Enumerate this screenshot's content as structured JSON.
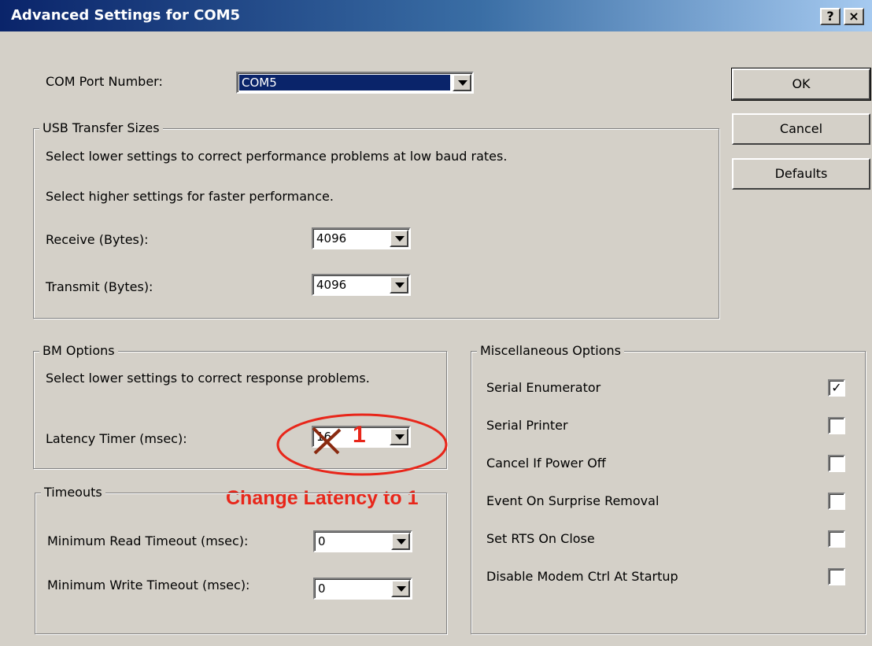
{
  "window": {
    "title": "Advanced Settings for COM5",
    "help_glyph": "?",
    "close_glyph": "×"
  },
  "com_port": {
    "label": "COM Port Number:",
    "value": "COM5"
  },
  "buttons": {
    "ok": "OK",
    "cancel": "Cancel",
    "defaults": "Defaults"
  },
  "usb": {
    "legend": "USB Transfer Sizes",
    "line1": "Select lower settings to correct performance problems at low baud rates.",
    "line2": "Select higher settings for faster performance.",
    "receive_label": "Receive (Bytes):",
    "receive_value": "4096",
    "transmit_label": "Transmit (Bytes):",
    "transmit_value": "4096"
  },
  "bm": {
    "legend": "BM Options",
    "desc": "Select lower settings to correct response problems.",
    "latency_label": "Latency Timer (msec):",
    "latency_value": "16"
  },
  "timeouts": {
    "legend": "Timeouts",
    "read_label": "Minimum Read Timeout (msec):",
    "read_value": "0",
    "write_label": "Minimum Write Timeout (msec):",
    "write_value": "0"
  },
  "misc": {
    "legend": "Miscellaneous Options",
    "options": [
      {
        "label": "Serial Enumerator",
        "checked": true
      },
      {
        "label": "Serial Printer",
        "checked": false
      },
      {
        "label": "Cancel If Power Off",
        "checked": false
      },
      {
        "label": "Event On Surprise Removal",
        "checked": false
      },
      {
        "label": "Set RTS On Close",
        "checked": false
      },
      {
        "label": "Disable Modem Ctrl At Startup",
        "checked": false
      }
    ],
    "check_glyph": "✓"
  },
  "annotation": {
    "new_value": "1",
    "note": "Change Latency to 1",
    "color": "#e8261a"
  }
}
